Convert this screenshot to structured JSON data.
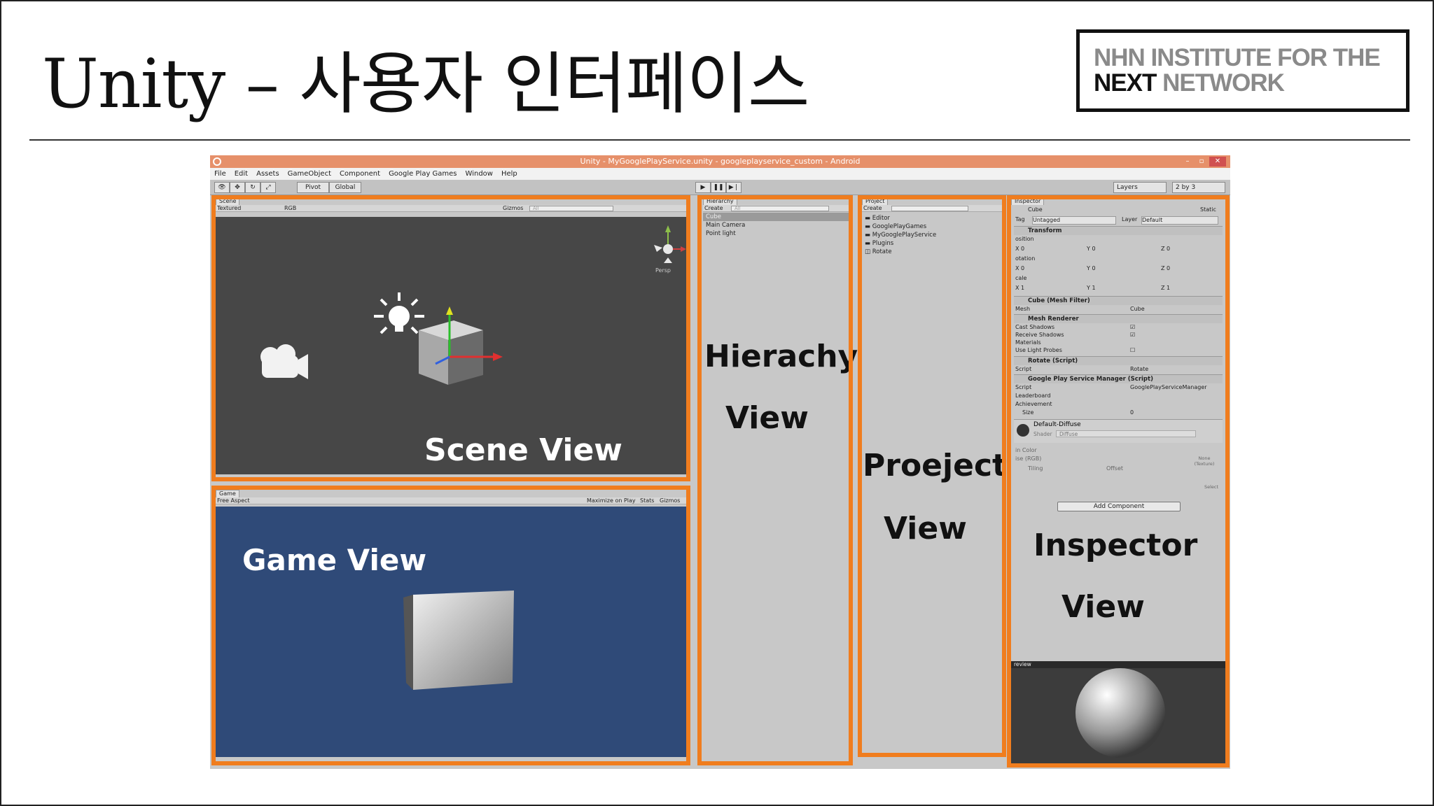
{
  "slide": {
    "title": "Unity – 사용자 인터페이스",
    "logo_line1": "NHN INSTITUTE FOR THE",
    "logo_line2_a": "NEXT",
    "logo_line2_b": " NETWORK"
  },
  "window": {
    "title": "Unity - MyGooglePlayService.unity - googleplayservice_custom - Android",
    "menu": [
      "File",
      "Edit",
      "Assets",
      "GameObject",
      "Component",
      "Google Play Games",
      "Window",
      "Help"
    ],
    "pivot": "Pivot",
    "global": "Global",
    "layers": "Layers",
    "layout": "2 by 3"
  },
  "scene": {
    "tab": "Scene",
    "textured": "Textured",
    "rgb": "RGB",
    "gizmos": "Gizmos",
    "search_placeholder": "All",
    "persp": "Persp",
    "label": "Scene View"
  },
  "game": {
    "tab": "Game",
    "aspect": "Free Aspect",
    "maximize": "Maximize on Play",
    "stats": "Stats",
    "gizmos": "Gizmos",
    "label": "Game View"
  },
  "hierarchy": {
    "tab": "Hierarchy",
    "create": "Create",
    "search": "All",
    "items": [
      "Cube",
      "Main Camera",
      "Point light"
    ],
    "label_line1": "Hierachy",
    "label_line2": "View"
  },
  "project": {
    "tab": "Project",
    "create": "Create",
    "items": [
      "Editor",
      "GooglePlayGames",
      "MyGooglePlayService",
      "Plugins",
      "Rotate"
    ],
    "label_line1": "Proeject",
    "label_line2": "View"
  },
  "inspector": {
    "tab": "Inspector",
    "object_name": "Cube",
    "static": "Static",
    "tag_label": "Tag",
    "tag_value": "Untagged",
    "layer_label": "Layer",
    "layer_value": "Default",
    "transform": "Transform",
    "position": "osition",
    "rotation": "otation",
    "scale": "cale",
    "pos": [
      "0",
      "0",
      "0"
    ],
    "rot": [
      "0",
      "0",
      "0"
    ],
    "scl": [
      "1",
      "1",
      "1"
    ],
    "mesh_filter": "Cube (Mesh Filter)",
    "mesh_label": "Mesh",
    "mesh_value": "Cube",
    "mesh_renderer": "Mesh Renderer",
    "cast_shadows": "Cast Shadows",
    "receive_shadows": "Receive Shadows",
    "materials": "Materials",
    "light_probes": "Use Light Probes",
    "rotate_script": "Rotate (Script)",
    "script_label": "Script",
    "rotate_value": "Rotate",
    "gps_manager": "Google Play Service Manager (Script)",
    "gps_value": "GooglePlayServiceManager",
    "leaderboard": "Leaderboard",
    "achievement": "Achievement",
    "size_label": "Size",
    "size_value": "0",
    "material": "Default-Diffuse",
    "shader_label": "Shader",
    "shader_value": "Diffuse",
    "main_color": "in Color",
    "base_rgb": "ise (RGB)",
    "tiling": "Tiling",
    "offset": "Offset",
    "none_texture": "None (Texture)",
    "select": "Select",
    "add_component": "Add Component",
    "label_line1": "Inspector",
    "label_line2": "View",
    "preview": "review"
  }
}
